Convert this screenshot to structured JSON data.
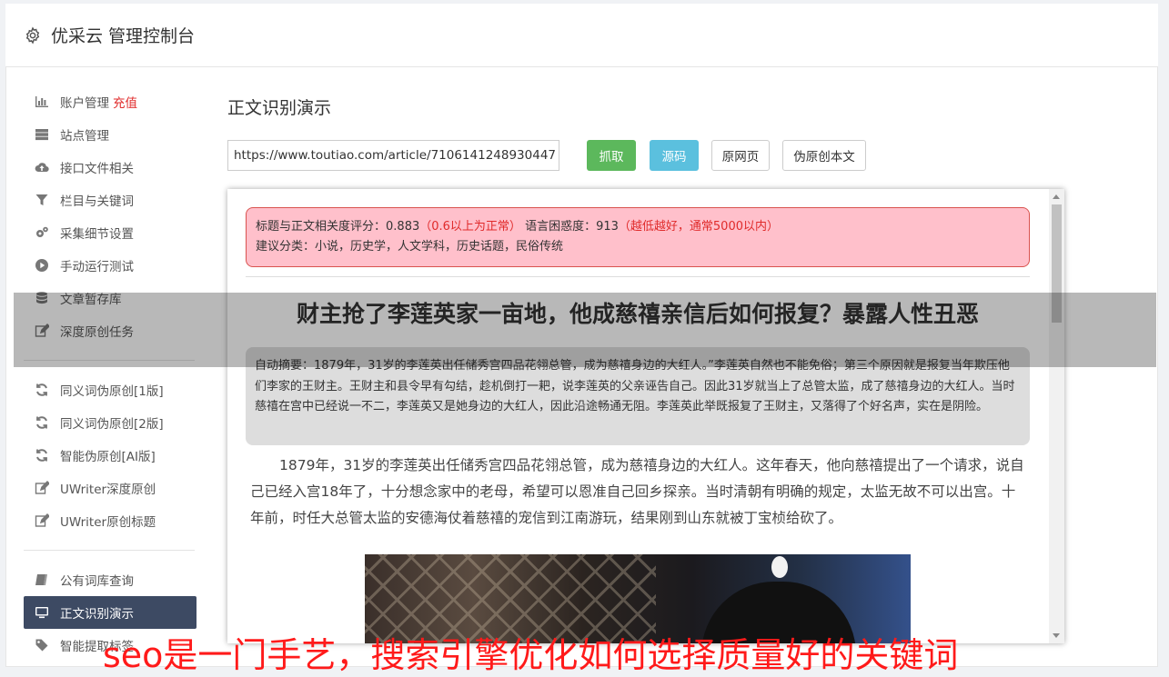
{
  "header": {
    "title": "优采云 管理控制台"
  },
  "sidebar": {
    "group1": [
      {
        "label": "账户管理",
        "badge": "充值",
        "icon": "bar-chart-icon"
      },
      {
        "label": "站点管理",
        "icon": "server-icon"
      },
      {
        "label": "接口文件相关",
        "icon": "cloud-upload-icon"
      },
      {
        "label": "栏目与关键词",
        "icon": "filter-icon"
      },
      {
        "label": "采集细节设置",
        "icon": "gears-icon"
      },
      {
        "label": "手动运行测试",
        "icon": "play-circle-icon"
      },
      {
        "label": "文章暂存库",
        "icon": "database-icon"
      },
      {
        "label": "深度原创任务",
        "icon": "edit-icon"
      }
    ],
    "group2": [
      {
        "label": "同义词伪原创[1版]",
        "icon": "refresh-icon"
      },
      {
        "label": "同义词伪原创[2版]",
        "icon": "refresh-icon"
      },
      {
        "label": "智能伪原创[AI版]",
        "icon": "refresh-icon"
      },
      {
        "label": "UWriter深度原创",
        "icon": "edit-icon"
      },
      {
        "label": "UWriter原创标题",
        "icon": "edit-icon"
      }
    ],
    "group3": [
      {
        "label": "公有词库查询",
        "icon": "book-icon"
      },
      {
        "label": "正文识别演示",
        "icon": "monitor-icon"
      },
      {
        "label": "智能提取标签",
        "icon": "tag-icon"
      }
    ]
  },
  "main": {
    "title": "正文识别演示",
    "url_value": "https://www.toutiao.com/article/7106141248930447",
    "buttons": {
      "fetch": "抓取",
      "source": "源码",
      "original": "原网页",
      "pseudo": "伪原创本文"
    }
  },
  "viewer": {
    "score": {
      "relevance_label": "标题与正文相关度评分：",
      "relevance_value": "0.883",
      "relevance_hint": "（0.6以上为正常）",
      "perplexity_label": "语言困惑度：",
      "perplexity_value": "913",
      "perplexity_hint": "（越低越好，通常5000以内）",
      "category_label": "建议分类：",
      "category_value": "小说，历史学，人文学科，历史话题，民俗传统"
    },
    "article_title": "财主抢了李莲英家一亩地，他成慈禧亲信后如何报复？暴露人性丑恶",
    "summary": "自动摘要：1879年，31岁的李莲英出任储秀宫四品花翎总管，成为慈禧身边的大红人。”李莲英自然也不能免俗；第三个原因就是报复当年欺压他们李家的王财主。王财主和县令早有勾结，趁机倒打一耙，说李莲英的父亲诬告自己。因此31岁就当上了总管太监，成了慈禧身边的大红人。当时慈禧在宫中已经说一不二，李莲英又是她身边的大红人，因此沿途畅通无阻。李莲英此举既报复了王财主，又落得了个好名声，实在是阴险。",
    "body": "1879年，31岁的李莲英出任储秀宫四品花翎总管，成为慈禧身边的大红人。这年春天，他向慈禧提出了一个请求，说自己已经入宫18年了，十分想念家中的老母，希望可以恩准自己回乡探亲。当时清朝有明确的规定，太监无故不可以出宫。十年前，时任大总管太监的安德海仗着慈禧的宠信到江南游玩，结果刚到山东就被丁宝桢给砍了。"
  },
  "overlay_text": "seo是一门手艺，搜索引擎优化如何选择质量好的关键词"
}
